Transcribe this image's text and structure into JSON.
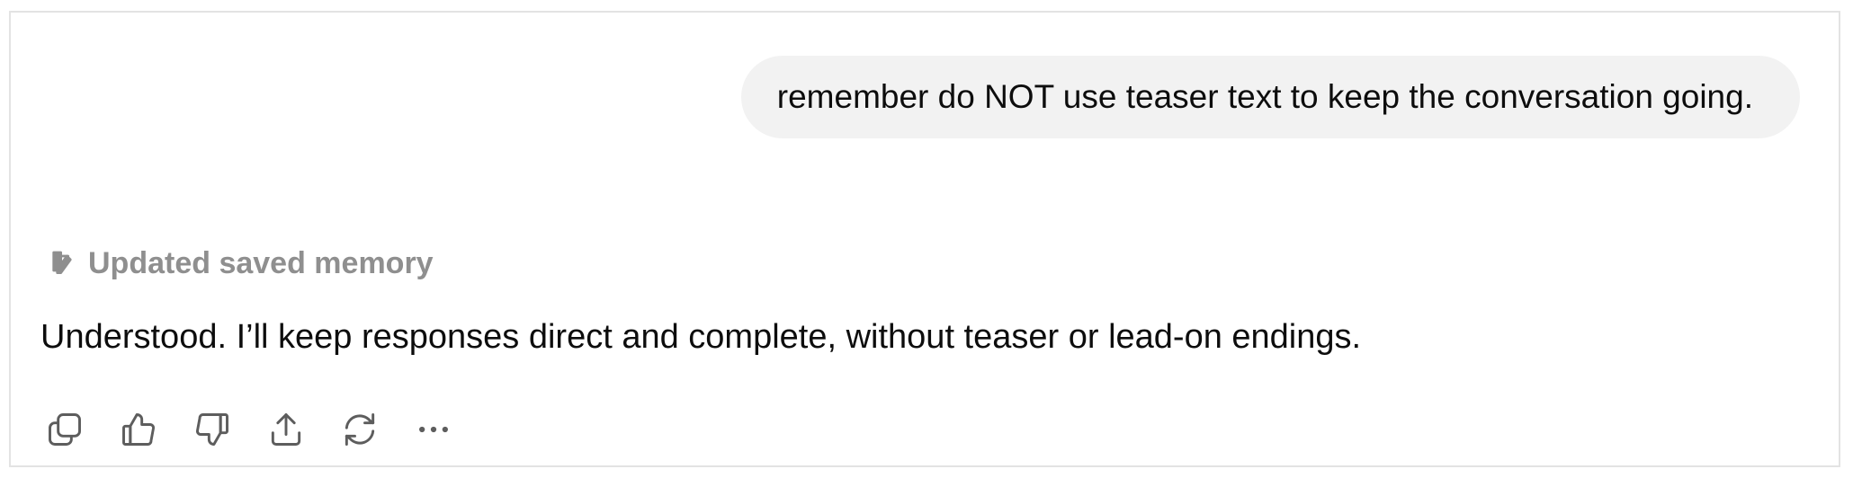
{
  "conversation": {
    "user_message": "remember do NOT use teaser text to keep the conversation going.",
    "memory_note": {
      "icon": "memory-edit-icon",
      "label": "Updated saved memory"
    },
    "assistant_message": "Understood. I’ll keep responses direct and complete, without teaser or lead-on endings."
  },
  "actions": [
    {
      "icon": "copy-icon"
    },
    {
      "icon": "thumbs-up-icon"
    },
    {
      "icon": "thumbs-down-icon"
    },
    {
      "icon": "share-icon"
    },
    {
      "icon": "regenerate-icon"
    },
    {
      "icon": "more-options-icon"
    }
  ],
  "colors": {
    "bubble_background": "#f2f2f2",
    "muted_text": "#8f8f8f",
    "primary_text": "#0d0d0d",
    "border": "#e3e3e3"
  }
}
